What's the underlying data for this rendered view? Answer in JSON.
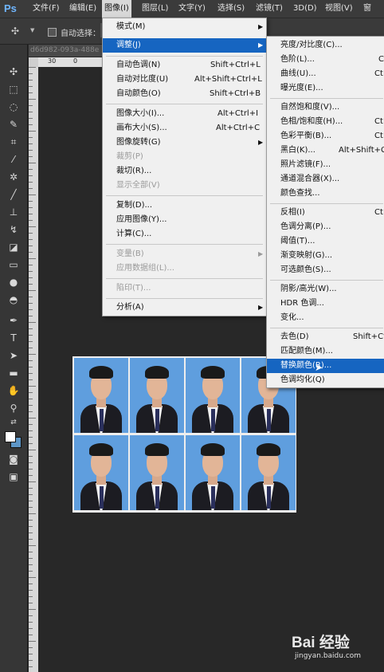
{
  "app": {
    "logo": "Ps"
  },
  "menubar": {
    "items": [
      "文件(F)",
      "编辑(E)",
      "图像(I)",
      "图层(L)",
      "文字(Y)",
      "选择(S)",
      "滤镜(T)",
      "3D(D)",
      "视图(V)",
      "窗"
    ],
    "active": "图像(I)"
  },
  "options_bar": {
    "auto_select_label": "自动选择："
  },
  "document": {
    "tab_title": "d6d982-093a-488e",
    "ruler_top": [
      "30",
      "0"
    ]
  },
  "image_menu": {
    "items": [
      {
        "label": "模式(M)",
        "shortcut": "",
        "submenu": true,
        "disabled": false
      },
      {
        "label": "调整(J)",
        "shortcut": "",
        "submenu": true,
        "disabled": false,
        "highlighted": true
      },
      {
        "label": "自动色调(N)",
        "shortcut": "Shift+Ctrl+L",
        "disabled": false
      },
      {
        "label": "自动对比度(U)",
        "shortcut": "Alt+Shift+Ctrl+L",
        "disabled": false
      },
      {
        "label": "自动颜色(O)",
        "shortcut": "Shift+Ctrl+B",
        "disabled": false
      },
      {
        "label": "图像大小(I)...",
        "shortcut": "Alt+Ctrl+I",
        "disabled": false
      },
      {
        "label": "画布大小(S)...",
        "shortcut": "Alt+Ctrl+C",
        "disabled": false
      },
      {
        "label": "图像旋转(G)",
        "shortcut": "",
        "submenu": true,
        "disabled": false
      },
      {
        "label": "裁剪(P)",
        "shortcut": "",
        "disabled": true
      },
      {
        "label": "裁切(R)...",
        "shortcut": "",
        "disabled": false
      },
      {
        "label": "显示全部(V)",
        "shortcut": "",
        "disabled": true
      },
      {
        "label": "复制(D)...",
        "shortcut": "",
        "disabled": false
      },
      {
        "label": "应用图像(Y)...",
        "shortcut": "",
        "disabled": false
      },
      {
        "label": "计算(C)...",
        "shortcut": "",
        "disabled": false
      },
      {
        "label": "变量(B)",
        "shortcut": "",
        "submenu": true,
        "disabled": true
      },
      {
        "label": "应用数据组(L)...",
        "shortcut": "",
        "disabled": true
      },
      {
        "label": "陷印(T)...",
        "shortcut": "",
        "disabled": true
      },
      {
        "label": "分析(A)",
        "shortcut": "",
        "submenu": true,
        "disabled": false
      }
    ]
  },
  "adjust_menu": {
    "items": [
      {
        "label": "亮度/对比度(C)...",
        "shortcut": ""
      },
      {
        "label": "色阶(L)...",
        "shortcut": "C"
      },
      {
        "label": "曲线(U)...",
        "shortcut": "Ct"
      },
      {
        "label": "曝光度(E)...",
        "shortcut": ""
      },
      {
        "label": "自然饱和度(V)...",
        "shortcut": ""
      },
      {
        "label": "色相/饱和度(H)...",
        "shortcut": "Ct"
      },
      {
        "label": "色彩平衡(B)...",
        "shortcut": "Ct"
      },
      {
        "label": "黑白(K)...",
        "shortcut": "Alt+Shift+Ct"
      },
      {
        "label": "照片滤镜(F)...",
        "shortcut": ""
      },
      {
        "label": "通道混合器(X)...",
        "shortcut": ""
      },
      {
        "label": "颜色查找...",
        "shortcut": ""
      },
      {
        "label": "反相(I)",
        "shortcut": "Ct"
      },
      {
        "label": "色调分离(P)...",
        "shortcut": ""
      },
      {
        "label": "阈值(T)...",
        "shortcut": ""
      },
      {
        "label": "渐变映射(G)...",
        "shortcut": ""
      },
      {
        "label": "可选颜色(S)...",
        "shortcut": ""
      },
      {
        "label": "阴影/高光(W)...",
        "shortcut": ""
      },
      {
        "label": "HDR 色调...",
        "shortcut": ""
      },
      {
        "label": "变化...",
        "shortcut": ""
      },
      {
        "label": "去色(D)",
        "shortcut": "Shift+Ct"
      },
      {
        "label": "匹配颜色(M)...",
        "shortcut": ""
      },
      {
        "label": "替换颜色(R)...",
        "shortcut": "",
        "highlighted": true
      },
      {
        "label": "色调均化(Q)",
        "shortcut": ""
      }
    ]
  },
  "watermark": {
    "logo": "Bai 经验",
    "url": "jingyan.baidu.com"
  },
  "colors": {
    "highlight": "#1665c1",
    "photo_bg": "#5f9ede",
    "background_swatch": "#5d96c6"
  }
}
